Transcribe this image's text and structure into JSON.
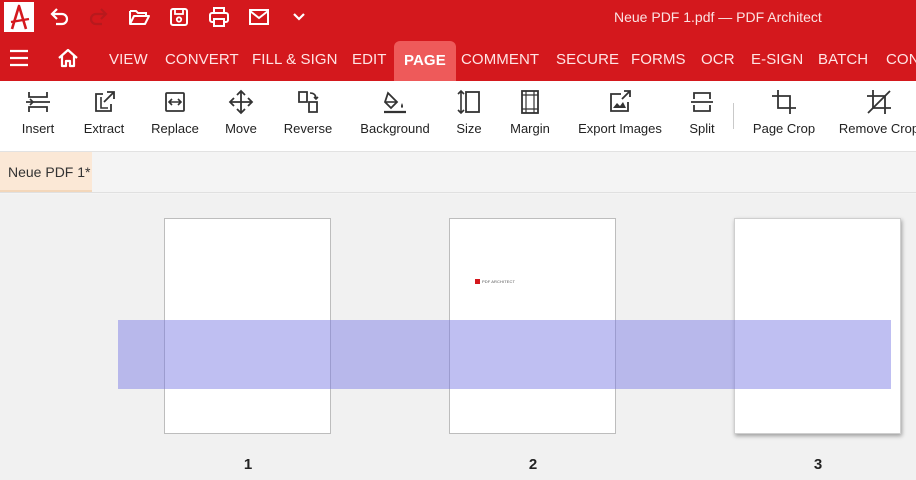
{
  "window": {
    "title": "Neue PDF 1.pdf  —  PDF Architect"
  },
  "quick_access": {
    "icons": [
      "app-logo",
      "undo-icon",
      "redo-icon",
      "open-folder-icon",
      "save-icon",
      "print-icon",
      "email-icon",
      "dropdown-chevron-icon"
    ]
  },
  "menu": {
    "tabs": [
      {
        "label": "VIEW"
      },
      {
        "label": "CONVERT"
      },
      {
        "label": "FILL & SIGN"
      },
      {
        "label": "EDIT"
      },
      {
        "label": "PAGE"
      },
      {
        "label": "COMMENT"
      },
      {
        "label": "SECURE"
      },
      {
        "label": "FORMS"
      },
      {
        "label": "OCR"
      },
      {
        "label": "E-SIGN"
      },
      {
        "label": "BATCH"
      },
      {
        "label": "CONVERT"
      }
    ],
    "active_tab": "PAGE"
  },
  "ribbon": {
    "buttons": [
      {
        "label": "Insert",
        "icon": "insert-page-icon"
      },
      {
        "label": "Extract",
        "icon": "extract-page-icon"
      },
      {
        "label": "Replace",
        "icon": "replace-page-icon"
      },
      {
        "label": "Move",
        "icon": "move-page-icon"
      },
      {
        "label": "Reverse",
        "icon": "reverse-pages-icon"
      },
      {
        "label": "Background",
        "icon": "paint-bucket-icon"
      },
      {
        "label": "Size",
        "icon": "page-size-icon"
      },
      {
        "label": "Margin",
        "icon": "page-margin-icon"
      },
      {
        "label": "Export Images",
        "icon": "export-images-icon"
      },
      {
        "label": "Split",
        "icon": "split-document-icon"
      },
      {
        "label": "Page Crop",
        "icon": "crop-icon"
      },
      {
        "label": "Remove Crop",
        "icon": "remove-crop-icon"
      }
    ]
  },
  "document_tabs": [
    {
      "label": "Neue PDF 1*"
    }
  ],
  "pages": [
    {
      "number": "1",
      "selected": false
    },
    {
      "number": "2",
      "selected": false,
      "content": "PDF ARCHITECT"
    },
    {
      "number": "3",
      "selected": true
    }
  ],
  "colors": {
    "brand_red": "#d4181d",
    "active_tab": "#ee5a5a",
    "selection": "#7878e4",
    "document_tab": "#fbe8d6"
  }
}
